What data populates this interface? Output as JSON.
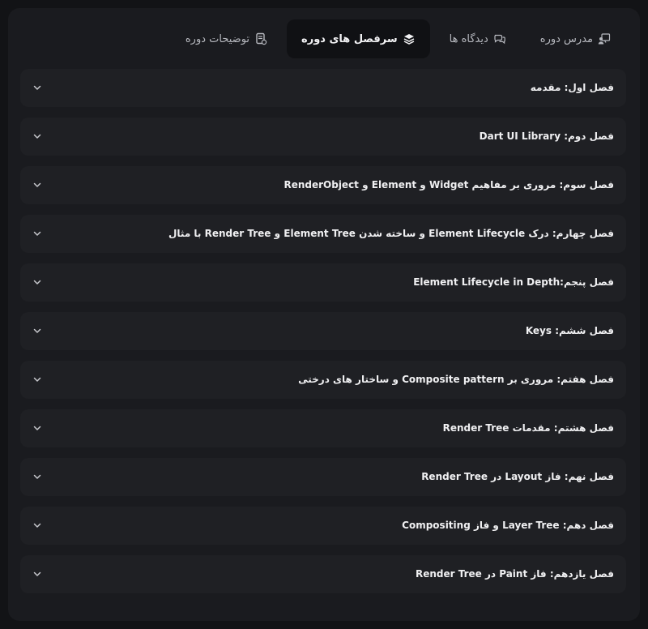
{
  "tabs": [
    {
      "label": "توضیحات دوره",
      "icon": "document-icon",
      "active": false
    },
    {
      "label": "سرفصل های دوره",
      "icon": "layers-icon",
      "active": true
    },
    {
      "label": "دیدگاه ها",
      "icon": "comments-icon",
      "active": false
    },
    {
      "label": "مدرس دوره",
      "icon": "teacher-icon",
      "active": false
    }
  ],
  "chapters": [
    "فصل اول: مقدمه",
    "فصل دوم: Dart UI Library",
    "فصل سوم: مروری بر مفاهیم Widget و Element و RenderObject",
    "فصل چهارم: درک Element Lifecycle و ساخته شدن Element Tree و Render Tree با مثال",
    "فصل پنجم:Element Lifecycle in Depth",
    "فصل ششم: Keys",
    "فصل هفتم: مروری بر Composite pattern و ساختار های درختی",
    "فصل هشتم: مقدمات Render Tree",
    "فصل نهم: فاز Layout در Render Tree",
    "فصل دهم: Layer Tree و فاز Compositing",
    "فصل یازدهم: فاز Paint در Render Tree"
  ],
  "colors": {
    "background": "#121316",
    "panel": "#1a1b1f",
    "item": "#1f2024",
    "active_tab": "#101114",
    "text": "#f0f0f2",
    "muted_text": "#b7b9bf"
  }
}
